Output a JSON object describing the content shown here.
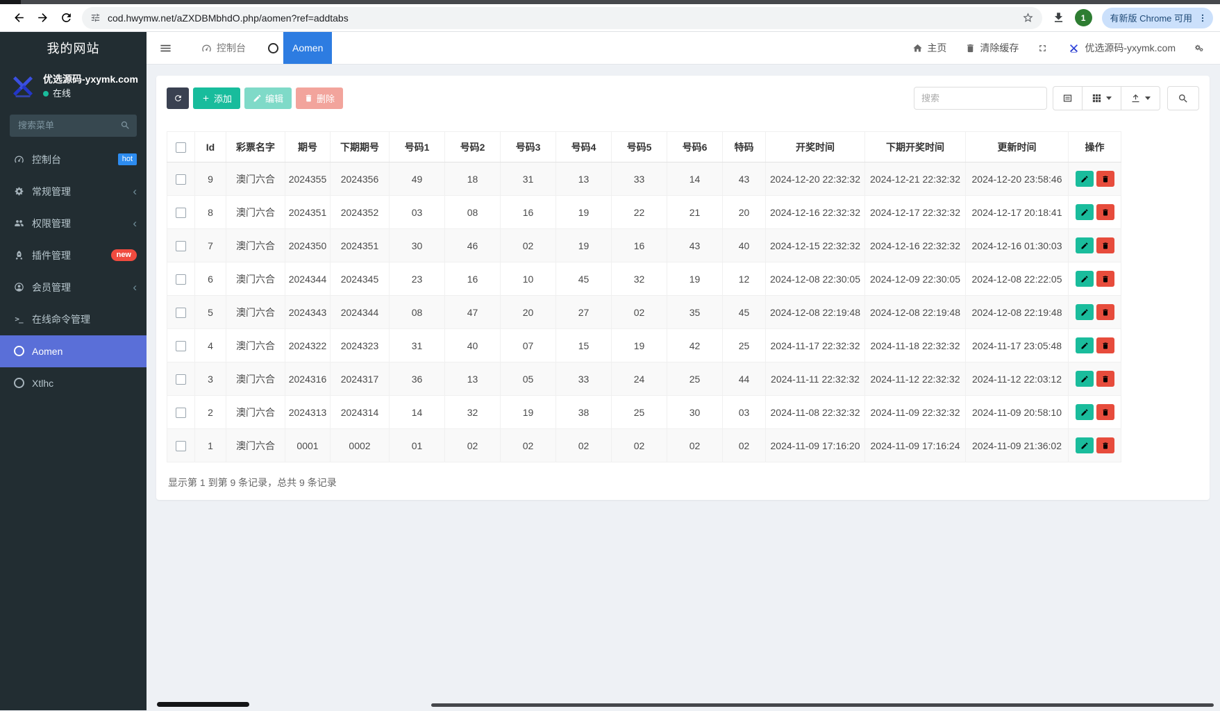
{
  "browser": {
    "url": "cod.hwymw.net/aZXDBMbhdO.php/aomen?ref=addtabs",
    "profile_badge": "1",
    "update_button": "有新版 Chrome 可用"
  },
  "sidebar": {
    "site_title": "我的网站",
    "user_name": "优选源码-yxymk.com",
    "user_status": "在线",
    "search_placeholder": "搜索菜单",
    "menu": [
      {
        "label": "控制台",
        "icon": "dashboard-icon",
        "badge": "hot",
        "badge_style": "blue",
        "active": false,
        "chevron": false
      },
      {
        "label": "常规管理",
        "icon": "cogs-icon",
        "badge": "",
        "badge_style": "",
        "active": false,
        "chevron": true
      },
      {
        "label": "权限管理",
        "icon": "users-icon",
        "badge": "",
        "badge_style": "",
        "active": false,
        "chevron": true
      },
      {
        "label": "插件管理",
        "icon": "rocket-icon",
        "badge": "new",
        "badge_style": "red",
        "active": false,
        "chevron": false
      },
      {
        "label": "会员管理",
        "icon": "user-circle-icon",
        "badge": "",
        "badge_style": "",
        "active": false,
        "chevron": true
      },
      {
        "label": "在线命令管理",
        "icon": "terminal-icon",
        "badge": "",
        "badge_style": "",
        "active": false,
        "chevron": false
      },
      {
        "label": "Aomen",
        "icon": "circle-icon",
        "badge": "",
        "badge_style": "",
        "active": true,
        "chevron": false
      },
      {
        "label": "Xtlhc",
        "icon": "circle-icon",
        "badge": "",
        "badge_style": "",
        "active": false,
        "chevron": false
      }
    ]
  },
  "topnav": {
    "tabs": [
      {
        "label": "控制台",
        "icon": "dashboard-icon",
        "active": false
      },
      {
        "label": "Aomen",
        "icon": "circle-icon",
        "active": true
      }
    ],
    "home_label": "主页",
    "clear_cache_label": "清除缓存",
    "site_name": "优选源码-yxymk.com"
  },
  "toolbar": {
    "add_label": "添加",
    "edit_label": "编辑",
    "delete_label": "删除",
    "search_placeholder": "搜索"
  },
  "table": {
    "columns": [
      "Id",
      "彩票名字",
      "期号",
      "下期期号",
      "号码1",
      "号码2",
      "号码3",
      "号码4",
      "号码5",
      "号码6",
      "特码",
      "开奖时间",
      "下期开奖时间",
      "更新时间",
      "操作"
    ],
    "rows": [
      [
        "9",
        "澳门六合",
        "2024355",
        "2024356",
        "49",
        "18",
        "31",
        "13",
        "33",
        "14",
        "43",
        "2024-12-20 22:32:32",
        "2024-12-21 22:32:32",
        "2024-12-20 23:58:46"
      ],
      [
        "8",
        "澳门六合",
        "2024351",
        "2024352",
        "03",
        "08",
        "16",
        "19",
        "22",
        "21",
        "20",
        "2024-12-16 22:32:32",
        "2024-12-17 22:32:32",
        "2024-12-17 20:18:41"
      ],
      [
        "7",
        "澳门六合",
        "2024350",
        "2024351",
        "30",
        "46",
        "02",
        "19",
        "16",
        "43",
        "40",
        "2024-12-15 22:32:32",
        "2024-12-16 22:32:32",
        "2024-12-16 01:30:03"
      ],
      [
        "6",
        "澳门六合",
        "2024344",
        "2024345",
        "23",
        "16",
        "10",
        "45",
        "32",
        "19",
        "12",
        "2024-12-08 22:30:05",
        "2024-12-09 22:30:05",
        "2024-12-08 22:22:05"
      ],
      [
        "5",
        "澳门六合",
        "2024343",
        "2024344",
        "08",
        "47",
        "20",
        "27",
        "02",
        "35",
        "45",
        "2024-12-08 22:19:48",
        "2024-12-08 22:19:48",
        "2024-12-08 22:19:48"
      ],
      [
        "4",
        "澳门六合",
        "2024322",
        "2024323",
        "31",
        "40",
        "07",
        "15",
        "19",
        "42",
        "25",
        "2024-11-17 22:32:32",
        "2024-11-18 22:32:32",
        "2024-11-17 23:05:48"
      ],
      [
        "3",
        "澳门六合",
        "2024316",
        "2024317",
        "36",
        "13",
        "05",
        "33",
        "24",
        "25",
        "44",
        "2024-11-11 22:32:32",
        "2024-11-12 22:32:32",
        "2024-11-12 22:03:12"
      ],
      [
        "2",
        "澳门六合",
        "2024313",
        "2024314",
        "14",
        "32",
        "19",
        "38",
        "25",
        "30",
        "03",
        "2024-11-08 22:32:32",
        "2024-11-09 22:32:32",
        "2024-11-09 20:58:10"
      ],
      [
        "1",
        "澳门六合",
        "0001",
        "0002",
        "01",
        "02",
        "02",
        "02",
        "02",
        "02",
        "02",
        "2024-11-09 17:16:20",
        "2024-11-09 17:16:24",
        "2024-11-09 21:36:02"
      ]
    ]
  },
  "footer": {
    "summary": "显示第 1 到第 9 条记录，总共 9 条记录"
  },
  "colors": {
    "sidebar_bg": "#222d32",
    "sidebar_active": "#5a6fd8",
    "tab_active": "#2d7ce1",
    "success": "#18bc9c",
    "danger": "#e74c3c",
    "hot_badge": "#2d8cf0",
    "new_badge": "#ef4b3f"
  }
}
